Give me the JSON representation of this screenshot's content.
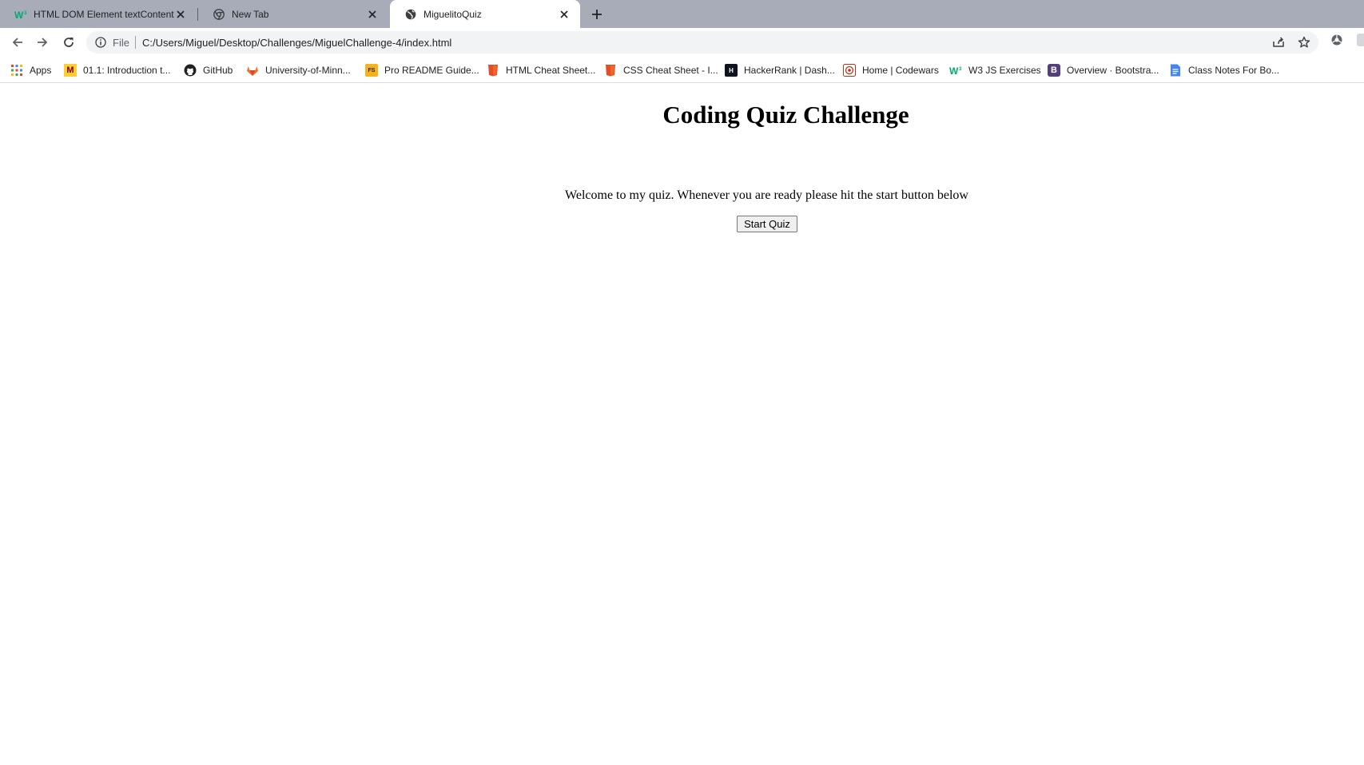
{
  "tabs": [
    {
      "title": "HTML DOM Element textContent",
      "favicon": "w3schools-icon",
      "active": false
    },
    {
      "title": "New Tab",
      "favicon": "chrome-icon",
      "active": false
    },
    {
      "title": "MiguelitoQuiz",
      "favicon": "globe-icon",
      "active": true
    }
  ],
  "toolbar": {
    "scheme": "File",
    "url": "C:/Users/Miguel/Desktop/Challenges/MiguelChallenge-4/index.html"
  },
  "bookmarks": [
    {
      "label": "Apps",
      "icon": "apps-grid-icon"
    },
    {
      "label": "01.1: Introduction t...",
      "icon": "minnesota-icon"
    },
    {
      "label": "GitHub",
      "icon": "github-icon"
    },
    {
      "label": "University-of-Minn...",
      "icon": "gitlab-icon"
    },
    {
      "label": "Pro README Guide...",
      "icon": "readme-icon"
    },
    {
      "label": "HTML Cheat Sheet...",
      "icon": "html-icon"
    },
    {
      "label": "CSS Cheat Sheet - I...",
      "icon": "css-icon"
    },
    {
      "label": "HackerRank | Dash...",
      "icon": "hackerrank-icon"
    },
    {
      "label": "Home | Codewars",
      "icon": "codewars-icon"
    },
    {
      "label": "W3 JS Exercises",
      "icon": "w3schools-icon"
    },
    {
      "label": "Overview · Bootstra...",
      "icon": "bootstrap-icon"
    },
    {
      "label": "Class Notes For Bo...",
      "icon": "docs-icon"
    }
  ],
  "page": {
    "heading": "Coding Quiz Challenge",
    "welcome": "Welcome to my quiz. Whenever you are ready please hit the start button below",
    "start_button": "Start Quiz"
  },
  "colors": {
    "tabstrip": "#a8acb8",
    "omnibox": "#f1f3f4",
    "text": "#202124"
  }
}
